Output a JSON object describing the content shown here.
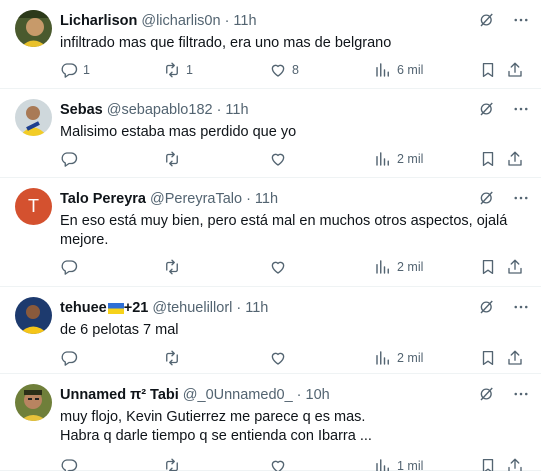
{
  "tweets": [
    {
      "name": "Licharlison",
      "handle": "@licharlis0n",
      "sep": "·",
      "time": "11h",
      "text": "infiltrado mas que filtrado, era uno mas de belgrano",
      "replies": "1",
      "reposts": "1",
      "likes": "8",
      "views": "6 mil"
    },
    {
      "name": "Sebas",
      "handle": "@sebapablo182",
      "sep": "·",
      "time": "11h",
      "text": "Malisimo estaba mas perdido que yo",
      "replies": "",
      "reposts": "",
      "likes": "",
      "views": "2 mil"
    },
    {
      "name": "Talo Pereyra",
      "handle": "@PereyraTalo",
      "sep": "·",
      "time": "11h",
      "avatar_letter": "T",
      "text": "En eso está muy bien, pero está mal en muchos otros aspectos, ojalá\nmejore.",
      "replies": "",
      "reposts": "",
      "likes": "",
      "views": "2 mil"
    },
    {
      "name": "tehuee",
      "name_suffix": "+21",
      "handle": "@tehuelillorl",
      "sep": "·",
      "time": "11h",
      "text": "de 6 pelotas 7 mal",
      "replies": "",
      "reposts": "",
      "likes": "",
      "views": "2 mil"
    },
    {
      "name": "Unnamed π² Tabi",
      "handle": "@_0Unnamed0_",
      "sep": "·",
      "time": "10h",
      "text": "muy flojo, Kevin Gutierrez me parece q es mas.\nHabra q darle tiempo q se entienda con Ibarra ...",
      "replies": "",
      "reposts": "",
      "likes": "",
      "views": "1 mil"
    }
  ],
  "icons": {
    "reply": "reply-icon",
    "repost": "repost-icon",
    "like": "heart-icon",
    "views": "views-icon",
    "bookmark": "bookmark-icon",
    "share": "share-icon",
    "grok": "grok-icon",
    "more": "more-icon"
  },
  "colors": {
    "text": "#0f1419",
    "muted": "#536471",
    "divider": "#eff3f4",
    "talo_avatar": "#d4512f"
  }
}
